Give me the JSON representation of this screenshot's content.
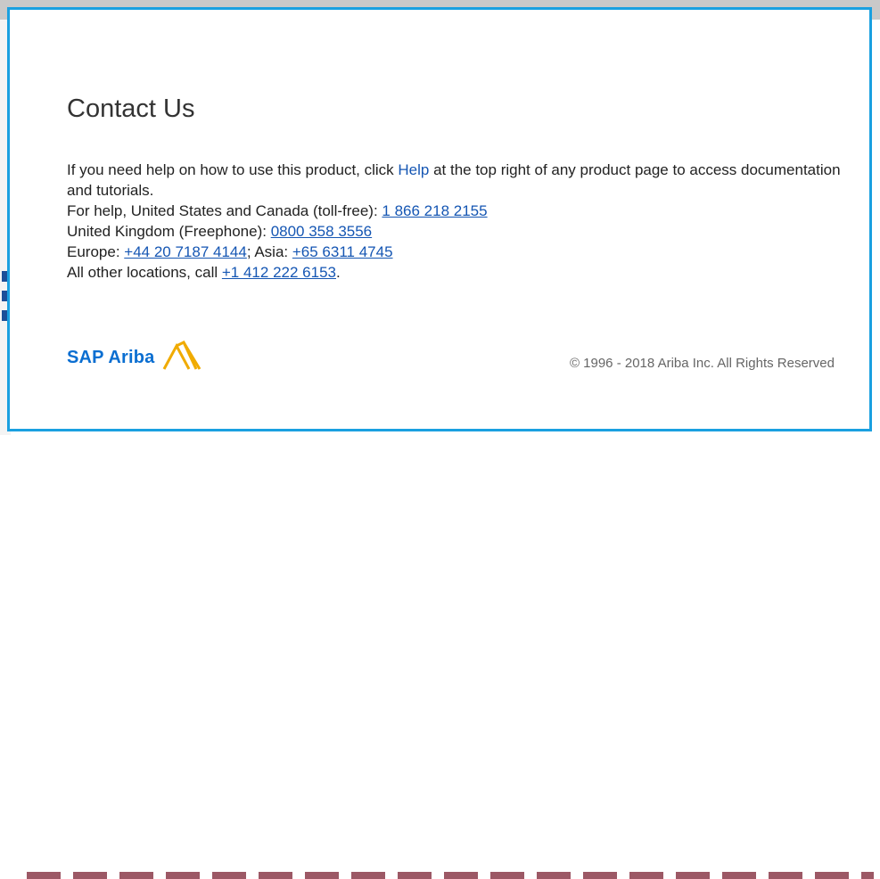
{
  "dialog": {
    "title": "Contact Us",
    "help_intro": "If you need help on how to use this product, click ",
    "help_link": "Help",
    "help_rest": " at the top right of any product page to access documentation and tutorials.",
    "us_label": "For help, United States and Canada (toll-free): ",
    "us_phone": "1 866 218 2155",
    "uk_label": "United Kingdom (Freephone): ",
    "uk_phone": "0800 358 3556",
    "europe_label": "Europe: ",
    "europe_phone": "+44 20 7187 4144",
    "asia_sep": "; Asia: ",
    "asia_phone": "+65 6311 4745",
    "other_label": "All other locations, call ",
    "other_phone": "+1 412 222 6153",
    "other_end": "."
  },
  "footer": {
    "logo_text": "SAP Ariba",
    "logo_icon": "ariba-logo-icon",
    "copyright": "© 1996 - 2018 Ariba Inc. All Rights Reserved"
  },
  "colors": {
    "border": "#1aa0e0",
    "link": "#1556b3",
    "logo_blue": "#0a6ed1",
    "logo_gold": "#f0ab00"
  }
}
